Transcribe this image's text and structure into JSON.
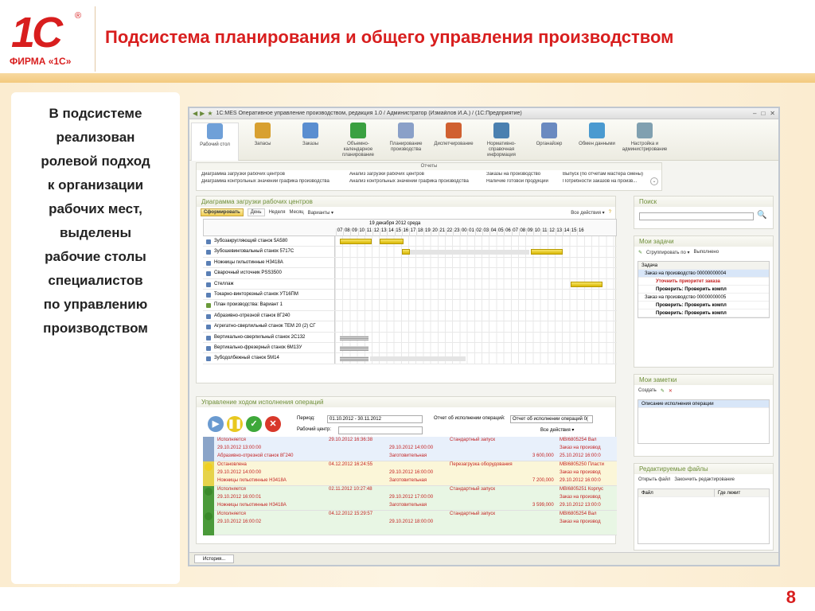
{
  "slide": {
    "logo_text": "1С",
    "logo_reg": "®",
    "logo_firm": "ФИРМА «1С»",
    "title": "Подсистема планирования и общего управления производством",
    "description_lines": [
      "В подсистеме",
      "реализован",
      "ролевой подход",
      "к организации",
      "рабочих мест,",
      "выделены",
      "рабочие столы",
      "специалистов",
      "по управлению",
      "производством"
    ],
    "page_number": "8"
  },
  "app": {
    "window_title": "1С:MES Оперативное управление производством, редакция 1.0 / Администратор (Измайлов И.А.) / (1С:Предприятие)",
    "sections": [
      {
        "label": "Рабочий стол",
        "color": "#6fa0d8"
      },
      {
        "label": "Запасы",
        "color": "#d8a030"
      },
      {
        "label": "Заказы",
        "color": "#5a8ed0"
      },
      {
        "label": "Объемно-календарное планирование",
        "color": "#3aa040"
      },
      {
        "label": "Планирование производства",
        "color": "#8aa0c8"
      },
      {
        "label": "Диспетчирование",
        "color": "#d06030"
      },
      {
        "label": "Нормативно-справочная информация",
        "color": "#4a80b0"
      },
      {
        "label": "Органайзер",
        "color": "#6a8ac0"
      },
      {
        "label": "Обмен данными",
        "color": "#4a9ad0"
      },
      {
        "label": "Настройка и администрирование",
        "color": "#80a0b0"
      }
    ],
    "reports": {
      "title": "Отчеты",
      "items": [
        "Диаграмма загрузки рабочих центров",
        "Анализ загрузки рабочих центров",
        "Заказы на производство",
        "Выпуск (по отчетам мастера смены)",
        "Диаграмма контрольных значений графика производства",
        "Анализ контрольных значений графика производства",
        "Наличие готовой продукции",
        "Потребности заказов на произв..."
      ]
    },
    "gantt": {
      "title": "Диаграмма загрузки рабочих центров",
      "btn_form": "Сформировать",
      "btn_day": "День",
      "btn_week": "Неделя",
      "btn_month": "Месяц",
      "btn_variants": "Варианты ▾",
      "all_actions": "Все действия ▾",
      "date_label": "19 декабря 2012 среда",
      "hours": [
        "07",
        "08",
        "09",
        "10",
        "11",
        "12",
        "13",
        "14",
        "15",
        "16",
        "17",
        "18",
        "19",
        "20",
        "21",
        "22",
        "23",
        "00",
        "01",
        "02",
        "03",
        "04",
        "05",
        "06",
        "07",
        "08",
        "09",
        "10",
        "11",
        "12",
        "13",
        "14",
        "15",
        "16"
      ],
      "rows": [
        "Зубозакругляющий станок 5А580",
        "Зубошевинговальный станок 5717С",
        "Ножницы гильотинные Н3418А",
        "Сварочный источник PSS3500",
        "Стеллаж",
        "Токарно-винторезный станок УТ16ПМ",
        "План производства: Вариант 1",
        "Абразивно-отрезной станок 8Г240",
        "Агрегатно-сверлильный станок ТЕМ 20 (2) СГ",
        "Вертикально-сверлильный станок 2С132",
        "Вертикально-фрезерный станок 6М13У",
        "Зубодолбежный станок 5М14"
      ]
    },
    "ops": {
      "title": "Управление ходом исполнения операций",
      "period_label": "Период:",
      "period_value": "01.10.2012 - 30.11.2012",
      "report_label": "Отчет об исполнении операций:",
      "report_value": "Отчет об исполнении операций 0(",
      "center_label": "Рабочий центр:",
      "all_actions": "Все действия ▾",
      "rows": [
        {
          "status": "Исполняется",
          "d1": "29.10.2012 16:36:38",
          "type": "Стандартный запуск",
          "id": "МВI6805254 Вал",
          "d2": "29.10.2012 13:00:00",
          "d3": "29.10.2012 14:00:00",
          "order": "Заказ на производ",
          "machine": "Абразивно-отрезной станок 8Г240",
          "stage": "Заготовительная",
          "amt": "3 600,000",
          "d4": "25.10.2012 16:00:0",
          "bg": "#e8f0fb",
          "strip": "#8aa4c8",
          "dot": "#8aa4c8"
        },
        {
          "status": "Остановлена",
          "d1": "04.12.2012 16:24:55",
          "type": "Перезагрузка оборудования",
          "id": "МВI6805250 Пласти",
          "d2": "29.10.2012 14:00:00",
          "d3": "29.10.2012 16:00:00",
          "order": "Заказ на производ",
          "machine": "Ножницы гильотинные Н3418А",
          "stage": "Заготовительная",
          "amt": "7 200,000",
          "d4": "29.10.2012 16:00:0",
          "bg": "#fbf6d8",
          "strip": "#e6d34a",
          "dot": "#f0d020"
        },
        {
          "status": "Исполняется",
          "d1": "02.11.2012 10:27:48",
          "type": "Стандартный запуск",
          "id": "МВI6805251 Корпус",
          "d2": "29.10.2012 16:00:01",
          "d3": "29.10.2012 17:00:00",
          "order": "Заказ на производ",
          "machine": "Ножницы гильотинные Н3418А",
          "stage": "Заготовительная",
          "amt": "3 599,000",
          "d4": "29.10.2012 13:00:0",
          "bg": "#e8f6e4",
          "strip": "#4a9a3a",
          "dot": "#3a8a2a"
        },
        {
          "status": "Исполняется",
          "d1": "04.12.2012 15:29:57",
          "type": "Стандартный запуск",
          "id": "МВI6805254 Вал",
          "d2": "29.10.2012 16:00:02",
          "d3": "29.10.2012 18:00:00",
          "order": "Заказ на производ",
          "machine": "",
          "stage": "",
          "amt": "",
          "d4": "",
          "bg": "#e8f6e4",
          "strip": "#4a9a3a",
          "dot": "#3a8a2a"
        }
      ]
    },
    "search": {
      "title": "Поиск"
    },
    "tasks": {
      "title": "Мои задачи",
      "group_btn": "Сгруппировать по ▾",
      "done_btn": "Выполнено",
      "col": "Задача",
      "rows": [
        "Заказ на производство 00000000004",
        "Уточнить приоритет заказа",
        "Проверить: Проверить компл",
        "Заказ на производство 00000000005",
        "Проверить: Проверить компл",
        "Проверить: Проверить компл"
      ]
    },
    "notes": {
      "title": "Мои заметки",
      "create_btn": "Создать",
      "item": "Описание исполнения операции"
    },
    "files": {
      "title": "Редактируемые файлы",
      "open_btn": "Открыть файл",
      "finish_btn": "Закончить редактирование",
      "col1": "Файл",
      "col2": "Где лежит"
    },
    "history_btn": "История..."
  }
}
